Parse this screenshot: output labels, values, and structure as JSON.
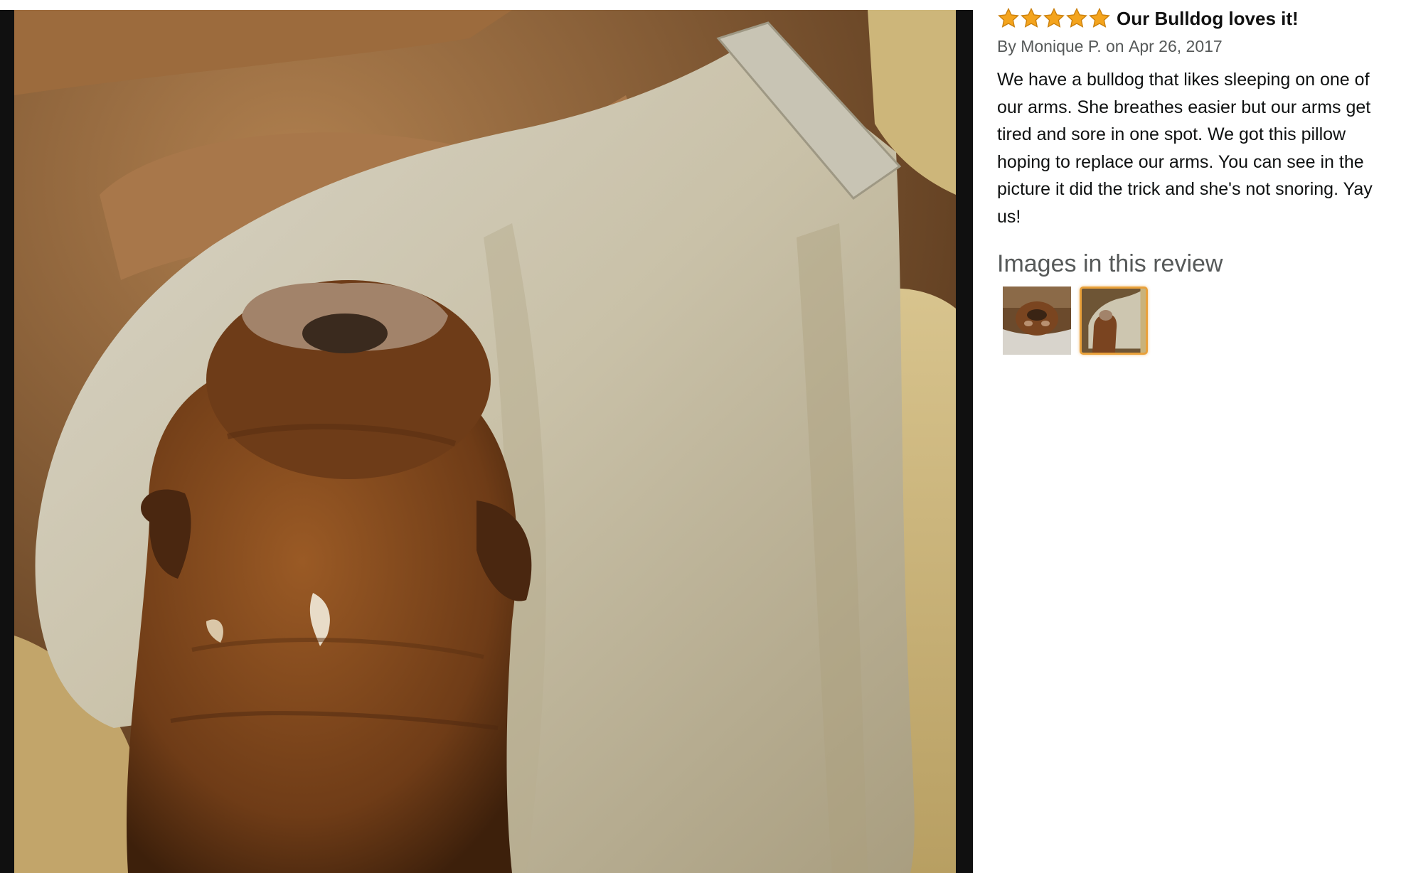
{
  "review": {
    "rating": 5,
    "title": "Our Bulldog loves it!",
    "byline_prefix": "By ",
    "author": "Monique P.",
    "byline_date_prefix": " on ",
    "date": "Apr 26, 2017",
    "body": "We have a bulldog that likes sleeping on one of our arms. She breathes easier but our arms get tired and sore in one spot. We got this pillow hoping to replace our arms. You can see in the picture it did the trick and she's not snoring. Yay us!"
  },
  "images_section": {
    "heading": "Images in this review",
    "thumbnails": [
      {
        "selected": false
      },
      {
        "selected": true
      }
    ]
  },
  "colors": {
    "star": "#f4a41d",
    "star_outline": "#c97f0c",
    "selected_border": "#e9a13b",
    "secondary_text": "#565959"
  }
}
